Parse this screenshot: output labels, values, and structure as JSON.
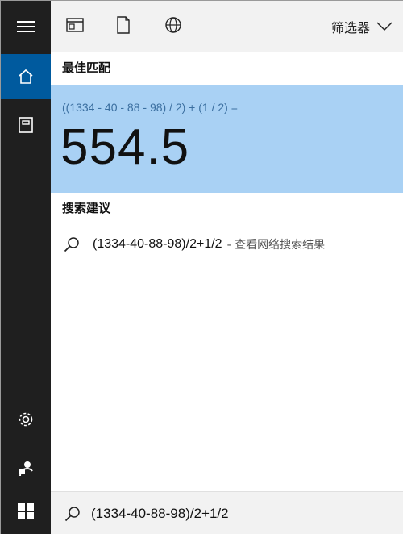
{
  "topbar": {
    "icons": [
      "app-window-icon",
      "document-icon",
      "globe-icon"
    ],
    "filter_label": "筛选器"
  },
  "best_match": {
    "label": "最佳匹配",
    "expression": "((1334 - 40 - 88 - 98) / 2) + (1 / 2) =",
    "result": "554.5"
  },
  "suggestions": {
    "label": "搜索建议",
    "items": [
      {
        "query": "(1334-40-88-98)/2+1/2",
        "hint": "- 查看网络搜索结果"
      }
    ]
  },
  "search": {
    "value": "(1334-40-88-98)/2+1/2"
  },
  "colors": {
    "rail_bg": "#1f1f1f",
    "active_rail": "#005a9e",
    "selected_card": "#a9d1f4",
    "topbar_bg": "#f2f2f2"
  }
}
